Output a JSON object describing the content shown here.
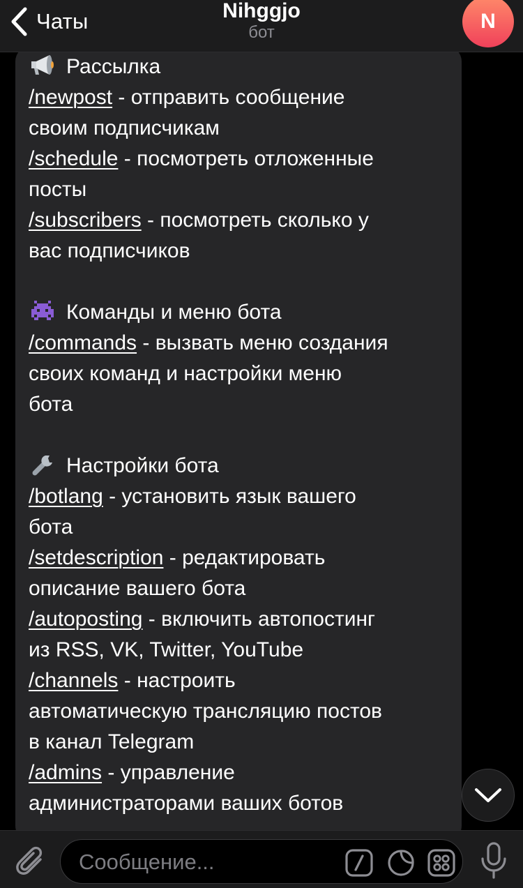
{
  "header": {
    "back_label": "Чаты",
    "title": "Nihggjo",
    "subtitle": "бот",
    "avatar_letter": "N"
  },
  "message": {
    "sections": [
      {
        "icon": "megaphone-icon",
        "heading": "Рассылка",
        "commands": [
          {
            "cmd": "/newpost",
            "lines": [
              " - отправить сообщение",
              "своим подписчикам"
            ]
          },
          {
            "cmd": "/schedule",
            "lines": [
              " - посмотреть отложенные",
              "посты"
            ]
          },
          {
            "cmd": "/subscribers",
            "lines": [
              " - посмотреть сколько у",
              "вас подписчиков"
            ]
          }
        ]
      },
      {
        "icon": "space-invader-icon",
        "heading": "Команды и меню бота",
        "commands": [
          {
            "cmd": "/commands",
            "lines": [
              " - вызвать меню создания",
              "своих команд и настройки меню",
              "бота"
            ]
          }
        ]
      },
      {
        "icon": "wrench-icon",
        "heading": "Настройки бота",
        "commands": [
          {
            "cmd": "/botlang",
            "lines": [
              " - установить язык вашего",
              "бота"
            ]
          },
          {
            "cmd": "/setdescription",
            "lines": [
              " - редактировать",
              "описание вашего бота"
            ]
          },
          {
            "cmd": "/autoposting",
            "lines": [
              " - включить автопостинг",
              "из RSS, VK, Twitter, YouTube"
            ]
          },
          {
            "cmd": "/channels",
            "lines": [
              " - настроить",
              "автоматическую трансляцию постов",
              "в канал Telegram"
            ]
          },
          {
            "cmd": "/admins",
            "lines": [
              " - управление",
              "администраторами ваших ботов"
            ]
          }
        ]
      }
    ]
  },
  "composer": {
    "placeholder": "Сообщение..."
  },
  "colors": {
    "background": "#000000",
    "bar": "#1c1c1d",
    "bubble": "#262628",
    "avatar_top": "#ff8a6a",
    "avatar_bottom": "#f0415a"
  }
}
